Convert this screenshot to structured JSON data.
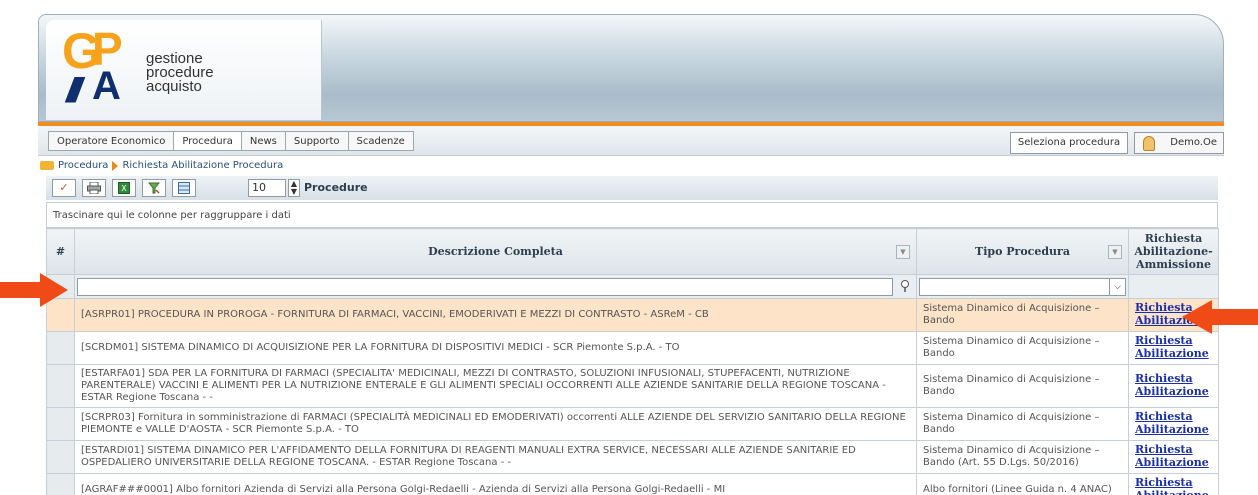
{
  "logo": {
    "text_line1": "gestione",
    "text_line2": "procedure",
    "text_line3": "acquisto"
  },
  "menu": {
    "tabs": [
      "Operatore Economico",
      "Procedura",
      "News",
      "Supporto",
      "Scadenze"
    ],
    "active_tab": "Procedura",
    "select_procedure": "Seleziona procedura",
    "user_name": "Demo.Oe"
  },
  "breadcrumb": {
    "items": [
      "Procedura",
      "Richiesta Abilitazione Procedura"
    ]
  },
  "toolbar": {
    "page_size": "10",
    "title": "Procedure"
  },
  "grid": {
    "group_hint": "Trascinare qui le colonne per raggruppare i dati",
    "headers": {
      "rownum": "#",
      "descrizione": "Descrizione Completa",
      "tipo": "Tipo Procedura",
      "richiesta": "Richiesta Abilitazione-Ammissione"
    },
    "rows": [
      {
        "descrizione": "[ASRPR01] PROCEDURA IN PROROGA - FORNITURA DI FARMACI, VACCINI, EMODERIVATI E MEZZI DI CONTRASTO - ASReM - CB",
        "tipo": "Sistema Dinamico di Acquisizione – Bando",
        "link": "Richiesta Abilitazione"
      },
      {
        "descrizione": "[SCRDM01] SISTEMA DINAMICO DI ACQUISIZIONE PER LA FORNITURA DI DISPOSITIVI MEDICI - SCR Piemonte S.p.A. - TO",
        "tipo": "Sistema Dinamico di Acquisizione – Bando",
        "link": "Richiesta Abilitazione"
      },
      {
        "descrizione": "[ESTARFA01] SDA PER LA FORNITURA DI FARMACI (SPECIALITA' MEDICINALI, MEZZI DI CONTRASTO, SOLUZIONI INFUSIONALI, STUPEFACENTI, NUTRIZIONE PARENTERALE) VACCINI E ALIMENTI PER LA NUTRIZIONE ENTERALE E GLI ALIMENTI SPECIALI OCCORRENTI ALLE AZIENDE SANITARIE DELLA REGIONE TOSCANA - ESTAR Regione Toscana - -",
        "tipo": "Sistema Dinamico di Acquisizione – Bando",
        "link": "Richiesta Abilitazione"
      },
      {
        "descrizione": "[SCRPR03] Fornitura in somministrazione di FARMACI (SPECIALITÀ MEDICINALI ED EMODERIVATI) occorrenti ALLE AZIENDE DEL SERVIZIO SANITARIO DELLA REGIONE PIEMONTE e VALLE D'AOSTA - SCR Piemonte S.p.A. - TO",
        "tipo": "Sistema Dinamico di Acquisizione – Bando",
        "link": "Richiesta Abilitazione"
      },
      {
        "descrizione": "[ESTARDI01] SISTEMA DINAMICO PER L'AFFIDAMENTO DELLA FORNITURA DI REAGENTI MANUALI EXTRA SERVICE, NECESSARI ALLE AZIENDE SANITARIE ED OSPEDALIERO UNIVERSITARIE DELLA REGIONE TOSCANA. - ESTAR Regione Toscana - -",
        "tipo": "Sistema Dinamico di Acquisizione – Bando (Art. 55 D.Lgs. 50/2016)",
        "link": "Richiesta Abilitazione"
      },
      {
        "descrizione": "[AGRAF###0001] Albo fornitori Azienda di Servizi alla Persona Golgi-Redaelli - Azienda di Servizi alla Persona Golgi-Redaelli - MI",
        "tipo": "Albo fornitori (Linee Guida n. 4 ANAC)",
        "link": "Richiesta Abilitazione"
      }
    ]
  },
  "colors": {
    "accent_orange": "#f28c1f",
    "link_blue": "#1a2ea8",
    "selected_row": "#fde3c8",
    "callout_arrow": "#f04b16"
  }
}
